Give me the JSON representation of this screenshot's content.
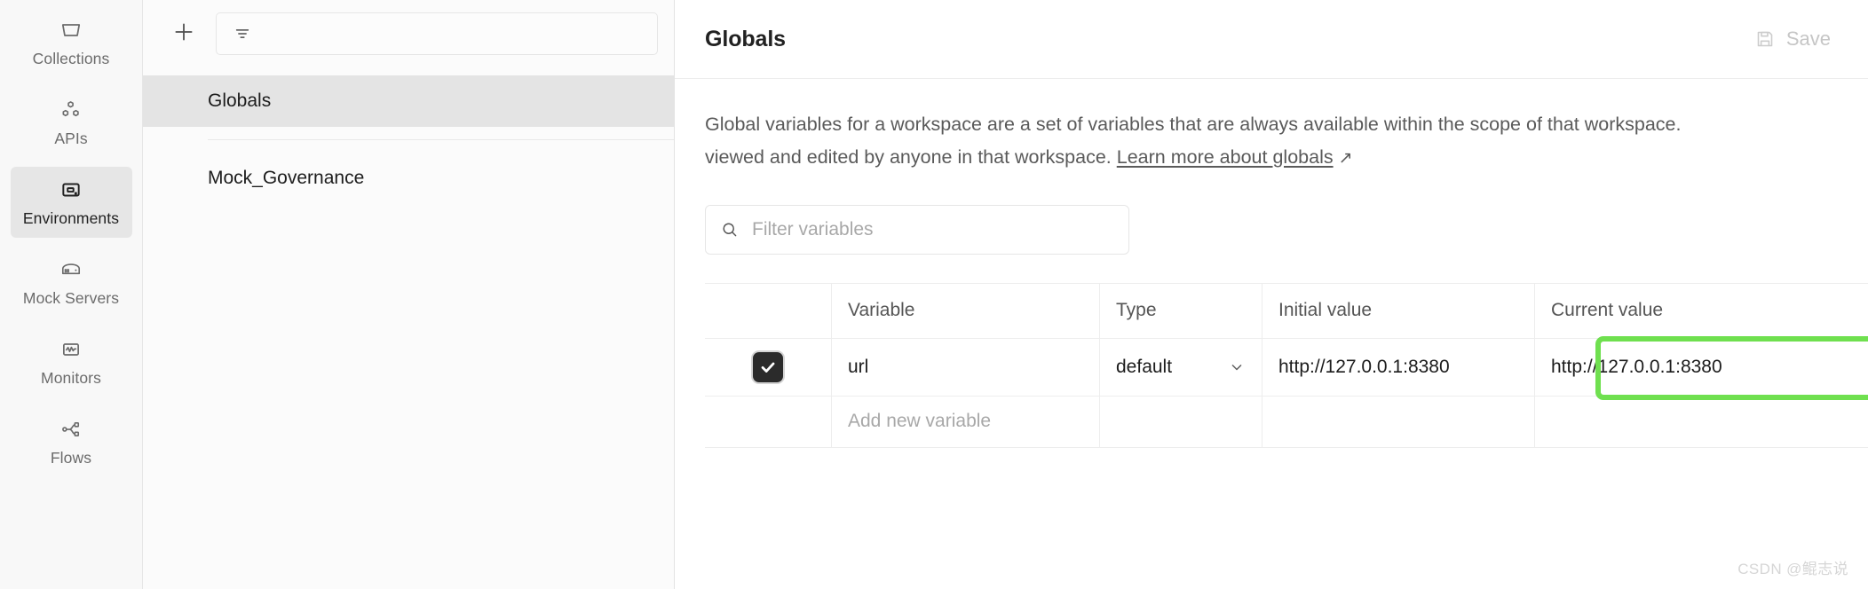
{
  "accent": {
    "highlight_green": "#6fe04f",
    "selected_bg": "#e4e4e4",
    "rail_active_bg": "#e6e6e6"
  },
  "rail": {
    "items": [
      {
        "label": "Collections",
        "icon": "collections-icon",
        "active": false
      },
      {
        "label": "APIs",
        "icon": "apis-icon",
        "active": false
      },
      {
        "label": "Environments",
        "icon": "environments-icon",
        "active": true
      },
      {
        "label": "Mock Servers",
        "icon": "mock-servers-icon",
        "active": false
      },
      {
        "label": "Monitors",
        "icon": "monitors-icon",
        "active": false
      },
      {
        "label": "Flows",
        "icon": "flows-icon",
        "active": false
      }
    ]
  },
  "env_panel": {
    "create_icon": "plus-icon",
    "filter_icon": "filter-icon",
    "filter_placeholder": "",
    "items": [
      {
        "label": "Globals",
        "selected": true
      },
      {
        "label": "Mock_Governance",
        "selected": false
      }
    ]
  },
  "main": {
    "title": "Globals",
    "save_label": "Save",
    "save_icon": "save-disk-icon",
    "description": {
      "line1": "Global variables for a workspace are a set of variables that are always available within the scope of that workspace.",
      "line2_prefix": "viewed and edited by anyone in that workspace.",
      "link_text": "Learn more about globals",
      "link_icon": "external-link-arrow-icon"
    },
    "search": {
      "icon": "search-icon",
      "placeholder": "Filter variables",
      "value": ""
    },
    "table": {
      "columns": [
        "Variable",
        "Type",
        "Initial value",
        "Current value"
      ],
      "rows": [
        {
          "enabled": true,
          "variable": "url",
          "type": "default",
          "type_chevron": "chevron-down-icon",
          "initial_value": "http://127.0.0.1:8380",
          "current_value": "http://127.0.0.1:8380",
          "highlighted": true
        }
      ],
      "add_row_placeholder": "Add new variable"
    }
  },
  "watermark": "CSDN @鲲志说"
}
